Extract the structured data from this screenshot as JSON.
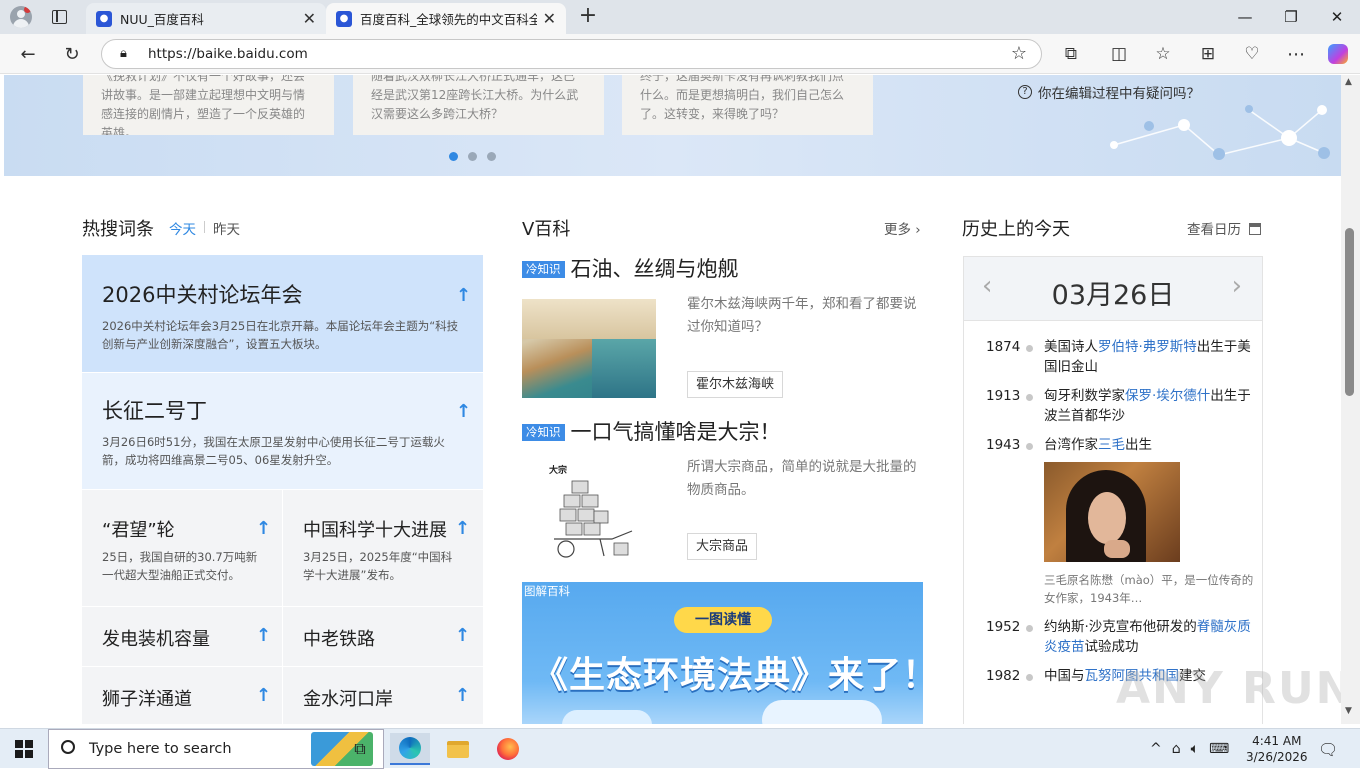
{
  "browser": {
    "tabs": [
      {
        "label": "NUU_百度百科"
      },
      {
        "label": "百度百科_全球领先的中文百科全书"
      }
    ],
    "url": "https://baike.baidu.com"
  },
  "banner": {
    "cards": [
      {
        "text": "《挽救计划》不仅有一个好故事，还会讲故事。是一部建立起理想中文明与情感连接的剧情片，塑造了一个反英雄的英雄。"
      },
      {
        "text": "随着武汉双柳长江大桥正式通车，这已经是武汉第12座跨长江大桥。为什么武汉需要这么多跨江大桥？"
      },
      {
        "text": "终于，这届奥斯卡没有再讽刺教我们点什么。而是更想搞明白，我们自己怎么了。这转变，来得晚了吗？"
      }
    ],
    "help_text": "你在编辑过程中有疑问吗？"
  },
  "hot": {
    "title": "热搜词条",
    "tab_today": "今天",
    "tab_yesterday": "昨天",
    "items": [
      {
        "title": "2026中关村论坛年会",
        "desc": "2026中关村论坛年会3月25日在北京开幕。本届论坛年会主题为“科技创新与产业创新深度融合”，设置五大板块。"
      },
      {
        "title": "长征二号丁",
        "desc": "3月26日6时51分，我国在太原卫星发射中心使用长征二号丁运载火箭，成功将四维高景二号05、06星发射升空。"
      },
      {
        "title": "“君望”轮",
        "desc": "25日，我国自研的30.7万吨新一代超大型油船正式交付。"
      },
      {
        "title": "中国科学十大进展",
        "desc": "3月25日，2025年度“中国科学十大进展”发布。"
      },
      {
        "title": "发电装机容量"
      },
      {
        "title": "中老铁路"
      },
      {
        "title": "狮子洋通道"
      },
      {
        "title": "金水河口岸"
      }
    ]
  },
  "vbaike": {
    "title": "V百科",
    "more": "更多",
    "articles": [
      {
        "tag": "冷知识",
        "title": "石油、丝绸与炮舰",
        "desc": "霍尔木兹海峡两千年，郑和看了都要说过你知道吗？",
        "keyword": "霍尔木兹海峡"
      },
      {
        "tag": "冷知识",
        "title": "一口气搞懂啥是大宗！",
        "desc": "所谓大宗商品，简单的说就是大批量的物质商品。",
        "keyword": "大宗商品",
        "img_label": "大宗"
      }
    ],
    "graphic": {
      "tag": "图解百科",
      "pill": "一图读懂",
      "headline": "《生态环境法典》来了！"
    }
  },
  "history": {
    "title": "历史上的今天",
    "calendar_link": "查看日历",
    "date": "03月26日",
    "events": [
      {
        "year": "1874",
        "pre": "美国诗人",
        "link": "罗伯特·弗罗斯特",
        "post": "出生于美国旧金山"
      },
      {
        "year": "1913",
        "pre": "匈牙利数学家",
        "link": "保罗·埃尔德什",
        "post": "出生于波兰首都华沙"
      },
      {
        "year": "1943",
        "pre": "台湾作家",
        "link": "三毛",
        "post": "出生",
        "caption": "三毛原名陈懋（mào）平，是一位传奇的女作家，1943年…"
      },
      {
        "year": "1952",
        "pre": "约纳斯·沙克宣布他研发的",
        "link": "脊髓灰质炎疫苗",
        "post": "试验成功"
      },
      {
        "year": "1982",
        "pre": "中国与",
        "link": "瓦努阿图共和国",
        "post": "建交"
      }
    ]
  },
  "watermark": "ANY RUN",
  "taskbar": {
    "search_placeholder": "Type here to search",
    "time": "4:41 AM",
    "date": "3/26/2026"
  }
}
